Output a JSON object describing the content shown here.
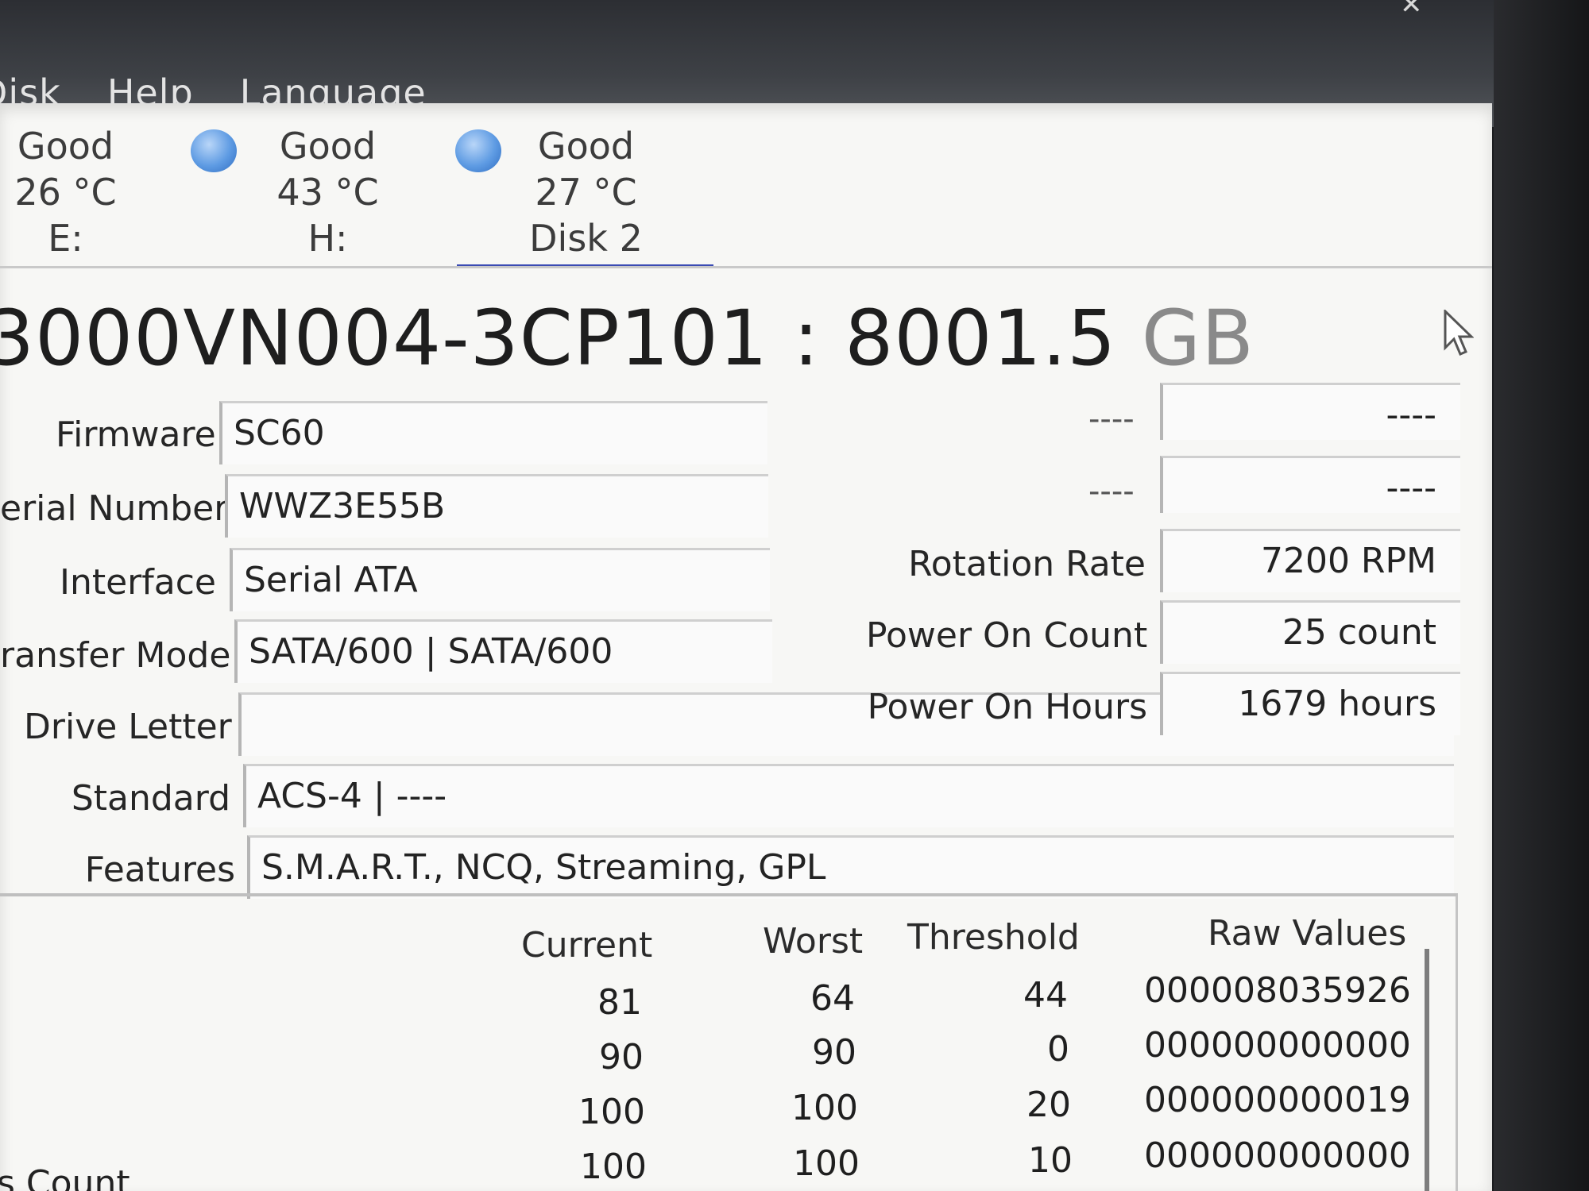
{
  "menu": [
    "Disk",
    "Help",
    "Language"
  ],
  "disks": [
    {
      "health": "Good",
      "temp": "26 °C",
      "label": "E:"
    },
    {
      "health": "Good",
      "temp": "43 °C",
      "label": "H:"
    },
    {
      "health": "Good",
      "temp": "27 °C",
      "label": "Disk 2"
    }
  ],
  "model": {
    "name": "3000VN004-3CP101 : 8001.5",
    "unit": "GB"
  },
  "left_fields": [
    {
      "label": "Firmware",
      "value": "SC60"
    },
    {
      "label": "erial Number",
      "value": "WWZ3E55B"
    },
    {
      "label": "Interface",
      "value": "Serial ATA"
    },
    {
      "label": "ransfer Mode",
      "value": "SATA/600 | SATA/600"
    },
    {
      "label": "Drive Letter",
      "value": ""
    },
    {
      "label": "Standard",
      "value": "ACS-4 | ----"
    },
    {
      "label": "Features",
      "value": "S.M.A.R.T., NCQ, Streaming, GPL"
    }
  ],
  "right_fields": [
    {
      "label": "----",
      "value": "----"
    },
    {
      "label": "----",
      "value": "----"
    },
    {
      "label": "Rotation Rate",
      "value": "7200 RPM"
    },
    {
      "label": "Power On Count",
      "value": "25 count"
    },
    {
      "label": "Power On Hours",
      "value": "1679 hours"
    }
  ],
  "smart_table": {
    "headers": [
      "Current",
      "Worst",
      "Threshold",
      "Raw Values"
    ],
    "rows": [
      {
        "current": "81",
        "worst": "64",
        "threshold": "44",
        "raw": "000008035926"
      },
      {
        "current": "90",
        "worst": "90",
        "threshold": "0",
        "raw": "000000000000"
      },
      {
        "current": "100",
        "worst": "100",
        "threshold": "20",
        "raw": "000000000019"
      },
      {
        "current": "100",
        "worst": "100",
        "threshold": "10",
        "raw": "000000000000"
      }
    ],
    "partial_attribute_label": "s Count"
  },
  "colors": {
    "status_good": "#5e9be3",
    "tab_underline": "#3a4bb3"
  }
}
